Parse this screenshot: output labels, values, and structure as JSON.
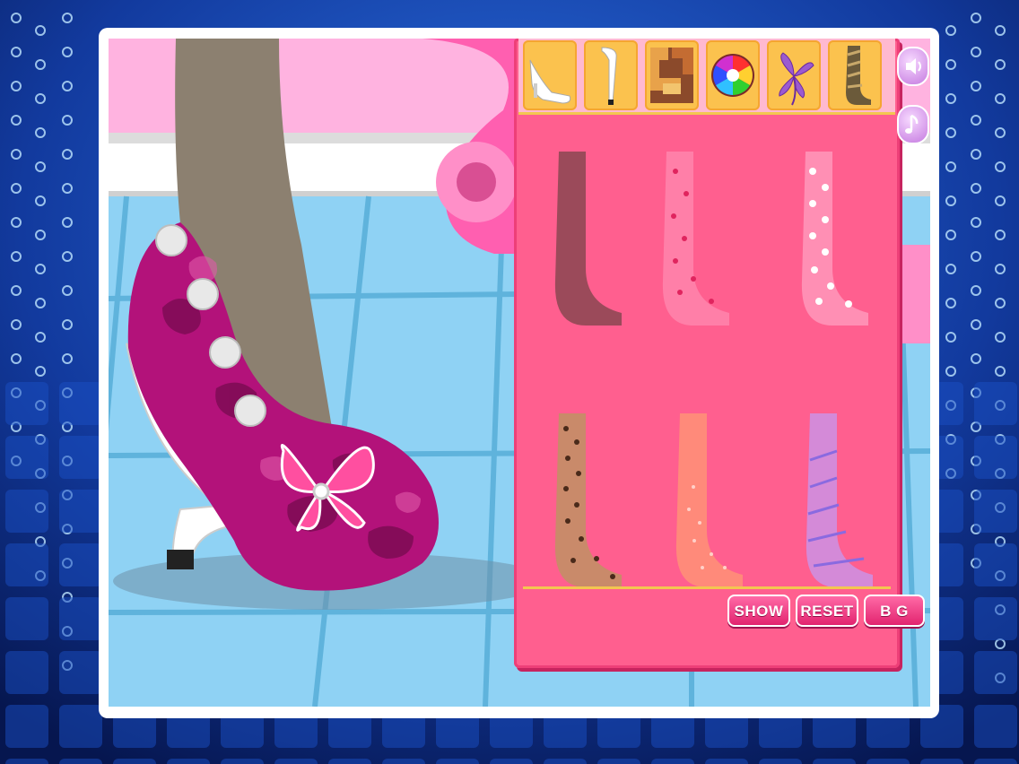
{
  "game": {
    "tabs": [
      {
        "name": "shoe",
        "icon": "shoe-icon"
      },
      {
        "name": "heel",
        "icon": "heel-icon"
      },
      {
        "name": "pattern",
        "icon": "pattern-icon"
      },
      {
        "name": "color",
        "icon": "color-wheel-icon"
      },
      {
        "name": "decoration",
        "icon": "flower-icon"
      },
      {
        "name": "socks",
        "icon": "sock-icon"
      }
    ],
    "items": [
      {
        "icon": "sock-icon",
        "style": "plain",
        "color": "#9b4a5a"
      },
      {
        "icon": "sock-icon",
        "style": "hearts",
        "color": "#ff7fa8"
      },
      {
        "icon": "sock-icon",
        "style": "polka-dots",
        "color": "#ff8fb4"
      },
      {
        "icon": "sock-icon",
        "style": "leopard",
        "color": "#c98a6a"
      },
      {
        "icon": "sock-icon",
        "style": "sparkle",
        "color": "#ff8a7a"
      },
      {
        "icon": "sock-icon",
        "style": "stripes",
        "color": "#d48ad8"
      }
    ],
    "buttons": {
      "show": "SHOW",
      "reset": "RESET",
      "bg": "B G"
    },
    "side_buttons": [
      {
        "name": "sound",
        "icon": "speaker-icon"
      },
      {
        "name": "music",
        "icon": "music-note-icon"
      }
    ]
  },
  "colors": {
    "panel": "#ff5f8f",
    "tab": "#fbc24e",
    "button": "#e2246f",
    "floor": "#8fd2f4",
    "wall": "#ffb3e0",
    "shoe": "#b3127a"
  }
}
